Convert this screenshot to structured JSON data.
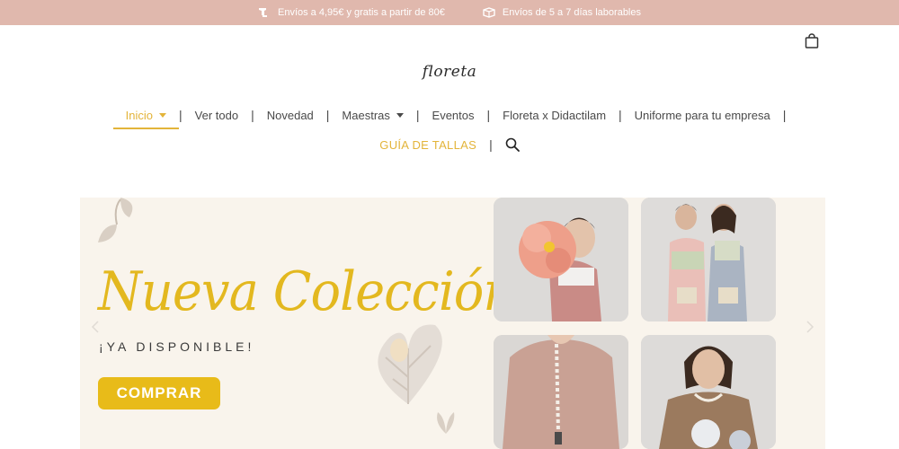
{
  "topbar": {
    "shipping_cost": "Envíos a 4,95€ y gratis a partir de 80€",
    "shipping_time": "Envíos de 5 a 7 días laborables"
  },
  "header": {
    "logo": "floreta"
  },
  "nav": {
    "items": [
      {
        "label": "Inicio"
      },
      {
        "label": "Ver todo"
      },
      {
        "label": "Novedad"
      },
      {
        "label": "Maestras"
      },
      {
        "label": "Eventos"
      },
      {
        "label": "Floreta x Didactilam"
      },
      {
        "label": "Uniforme para tu empresa"
      }
    ],
    "separator": "|",
    "guia": "GUÍA DE TALLAS"
  },
  "hero": {
    "title": "Nueva Colección",
    "subtitle": "¡YA DISPONIBLE!",
    "button": "COMPRAR"
  },
  "colors": {
    "topbar_bg": "#e0b8ad",
    "accent": "#e3b43a",
    "hero_bg": "#f9f4ec",
    "button_bg": "#e8bb19"
  },
  "icons": [
    "shipping-truck-icon",
    "box-icon",
    "shopping-bag-icon",
    "search-icon",
    "chevron-left-icon",
    "chevron-right-icon"
  ]
}
